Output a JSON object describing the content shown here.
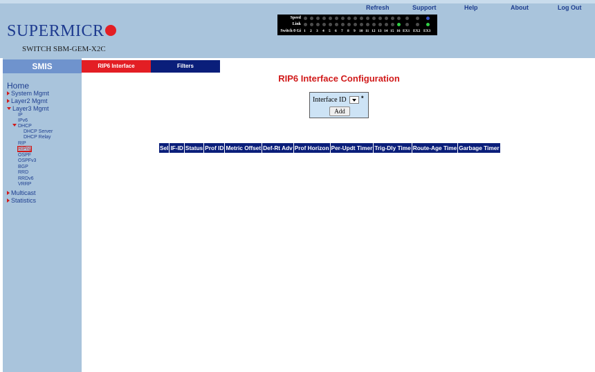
{
  "brand": {
    "logo_text": "SUPERMICR",
    "switch_name": "SWITCH SBM-GEM-X2C"
  },
  "top_links": [
    "Refresh",
    "Support",
    "Help",
    "About",
    "Log Out"
  ],
  "port_panel": {
    "row_labels": [
      "Speed",
      "Link",
      "Switch 0 Gi"
    ],
    "port_numbers": [
      "1",
      "2",
      "3",
      "4",
      "5",
      "6",
      "7",
      "8",
      "9",
      "10",
      "11",
      "12",
      "13",
      "14",
      "15",
      "16",
      "EX1",
      "EX2",
      "EX3"
    ]
  },
  "sidebar": {
    "header": "SMIS",
    "home": "Home",
    "items": [
      {
        "label": "System Mgmt"
      },
      {
        "label": "Layer2 Mgmt"
      },
      {
        "label": "Layer3 Mgmt"
      },
      {
        "label": "IP"
      },
      {
        "label": "IPv6"
      },
      {
        "label": "DHCP"
      },
      {
        "label": "DHCP Server"
      },
      {
        "label": "DHCP Relay"
      },
      {
        "label": "RIP"
      },
      {
        "label": "RIPng"
      },
      {
        "label": "OSPF"
      },
      {
        "label": "OSPFv3"
      },
      {
        "label": "BGP"
      },
      {
        "label": "RRD"
      },
      {
        "label": "RRDv6"
      },
      {
        "label": "VRRP"
      },
      {
        "label": "Multicast"
      },
      {
        "label": "Statistics"
      }
    ]
  },
  "tabs": [
    "RIP6 Interface",
    "Filters"
  ],
  "main": {
    "title": "RIP6 Interface Configuration",
    "interface_label": "Interface ID",
    "required_mark": "*",
    "add_label": "Add",
    "table_headers": [
      "Sel",
      "IF-ID",
      "Status",
      "Prof ID",
      "Metric Offset",
      "Def-Rt Adv",
      "Prof Horizon",
      "Per-Updt Timer",
      "Trig-Dly Time",
      "Route-Age Time",
      "Garbage Timer"
    ]
  },
  "colors": {
    "frame_blue": "#a9c4dc",
    "smis_tab": "#6f93cd",
    "accent_red": "#e31e24",
    "tab_navy": "#0a1e7a",
    "link_blue": "#1e3e8f",
    "led_on": "#31d046",
    "led_blue": "#3a55c8"
  }
}
